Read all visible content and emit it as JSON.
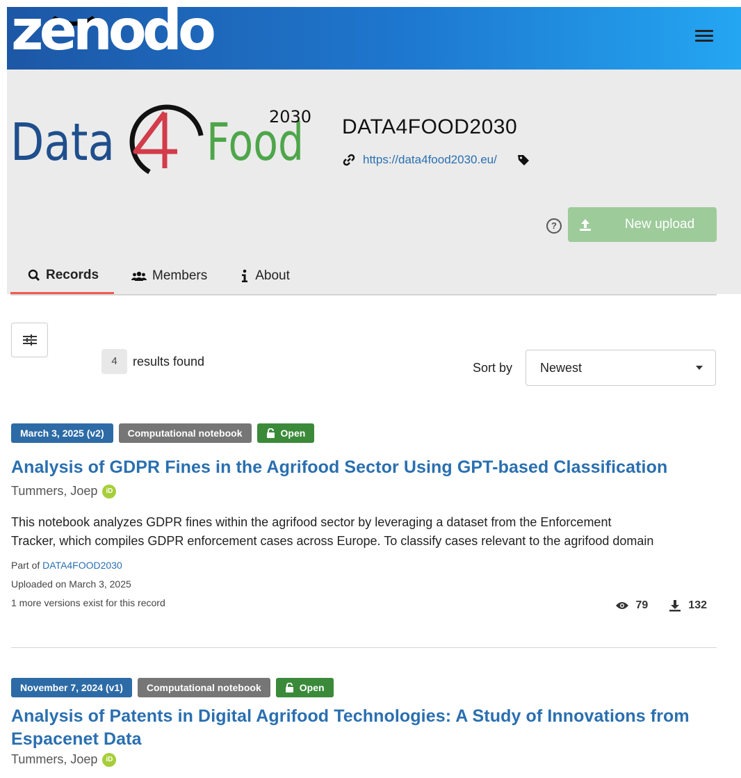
{
  "header": {
    "logo_text": "zenodo",
    "menu_icon": "hamburger-menu-icon"
  },
  "community": {
    "logo_text": "Data4Food",
    "logo_superscript": "2030",
    "title": "DATA4FOOD2030",
    "link": "https://data4food2030.eu/",
    "upload_label": "New upload",
    "help_icon": "question-circle-icon",
    "tabs": [
      {
        "label": "Records",
        "icon": "search-icon",
        "active": true
      },
      {
        "label": "Members",
        "icon": "users-icon",
        "active": false
      },
      {
        "label": "About",
        "icon": "info-icon",
        "active": false
      }
    ]
  },
  "results": {
    "count": "4",
    "found_label": "results found",
    "sort_label": "Sort by",
    "sort_value": "Newest"
  },
  "records": [
    {
      "date_badge": "March 3, 2025 (v2)",
      "type_badge": "Computational notebook",
      "access_badge": "Open",
      "title": "Analysis of GDPR Fines in the Agrifood Sector Using GPT-based Classification",
      "creator": "Tummers, Joep",
      "description_line1": "This notebook analyzes GDPR fines within the agrifood sector by leveraging a dataset from the Enforcement",
      "description_line2": "Tracker, which compiles GDPR enforcement cases across Europe. To classify cases relevant to the agrifood domain",
      "part_of_prefix": "Part of",
      "part_of": "DATA4FOOD2030",
      "uploaded": "Uploaded on March 3, 2025",
      "versions": "1 more versions exist for this record",
      "views": "79",
      "downloads": "132"
    },
    {
      "date_badge": "November 7, 2024 (v1)",
      "type_badge": "Computational notebook",
      "access_badge": "Open",
      "title_line1": "Analysis of Patents in Digital Agrifood Technologies: A Study of Innovations from",
      "title_line2": "Espacenet Data",
      "creator": "Tummers, Joep"
    }
  ],
  "colors": {
    "brand_blue": "#1e78cf",
    "link_blue": "#2a6fb0",
    "open_green": "#3a8a3a",
    "upload_green": "#9dcb9a",
    "tab_active_underline": "#f05a4f"
  }
}
